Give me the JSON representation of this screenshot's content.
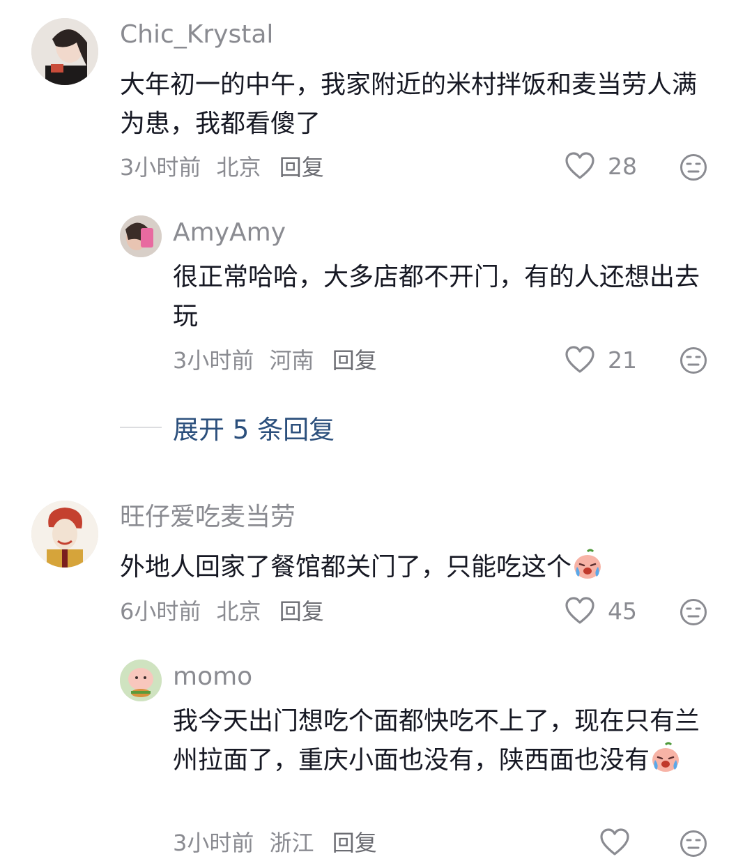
{
  "comments": [
    {
      "username": "Chic_Krystal",
      "text": "大年初一的中午，我家附近的米村拌饭和麦当劳人满为患，我都看傻了",
      "time": "3小时前",
      "location": "北京",
      "reply_label": "回复",
      "likes": "28"
    },
    {
      "username": "AmyAmy",
      "text": "很正常哈哈，大多店都不开门，有的人还想出去玩",
      "time": "3小时前",
      "location": "河南",
      "reply_label": "回复",
      "likes": "21"
    },
    {
      "username": "旺仔爱吃麦当劳",
      "text": "外地人回家了餐馆都关门了，只能吃这个",
      "time": "6小时前",
      "location": "北京",
      "reply_label": "回复",
      "likes": "45"
    },
    {
      "username": "momo",
      "text": "我今天出门想吃个面都快吃不上了，现在只有兰州拉面了，重庆小面也没有，陕西面也没有",
      "time": "3小时前",
      "location": "浙江",
      "reply_label": "回复",
      "likes": ""
    }
  ],
  "expand_replies": "展开 5 条回复",
  "icons": {
    "like": "heart-outline-icon",
    "dislike": "unamused-face-icon",
    "emoji": "crying-peach-emoji"
  },
  "colors": {
    "username": "#8a8b91",
    "text": "#161823",
    "expand": "#2b4f7c"
  }
}
